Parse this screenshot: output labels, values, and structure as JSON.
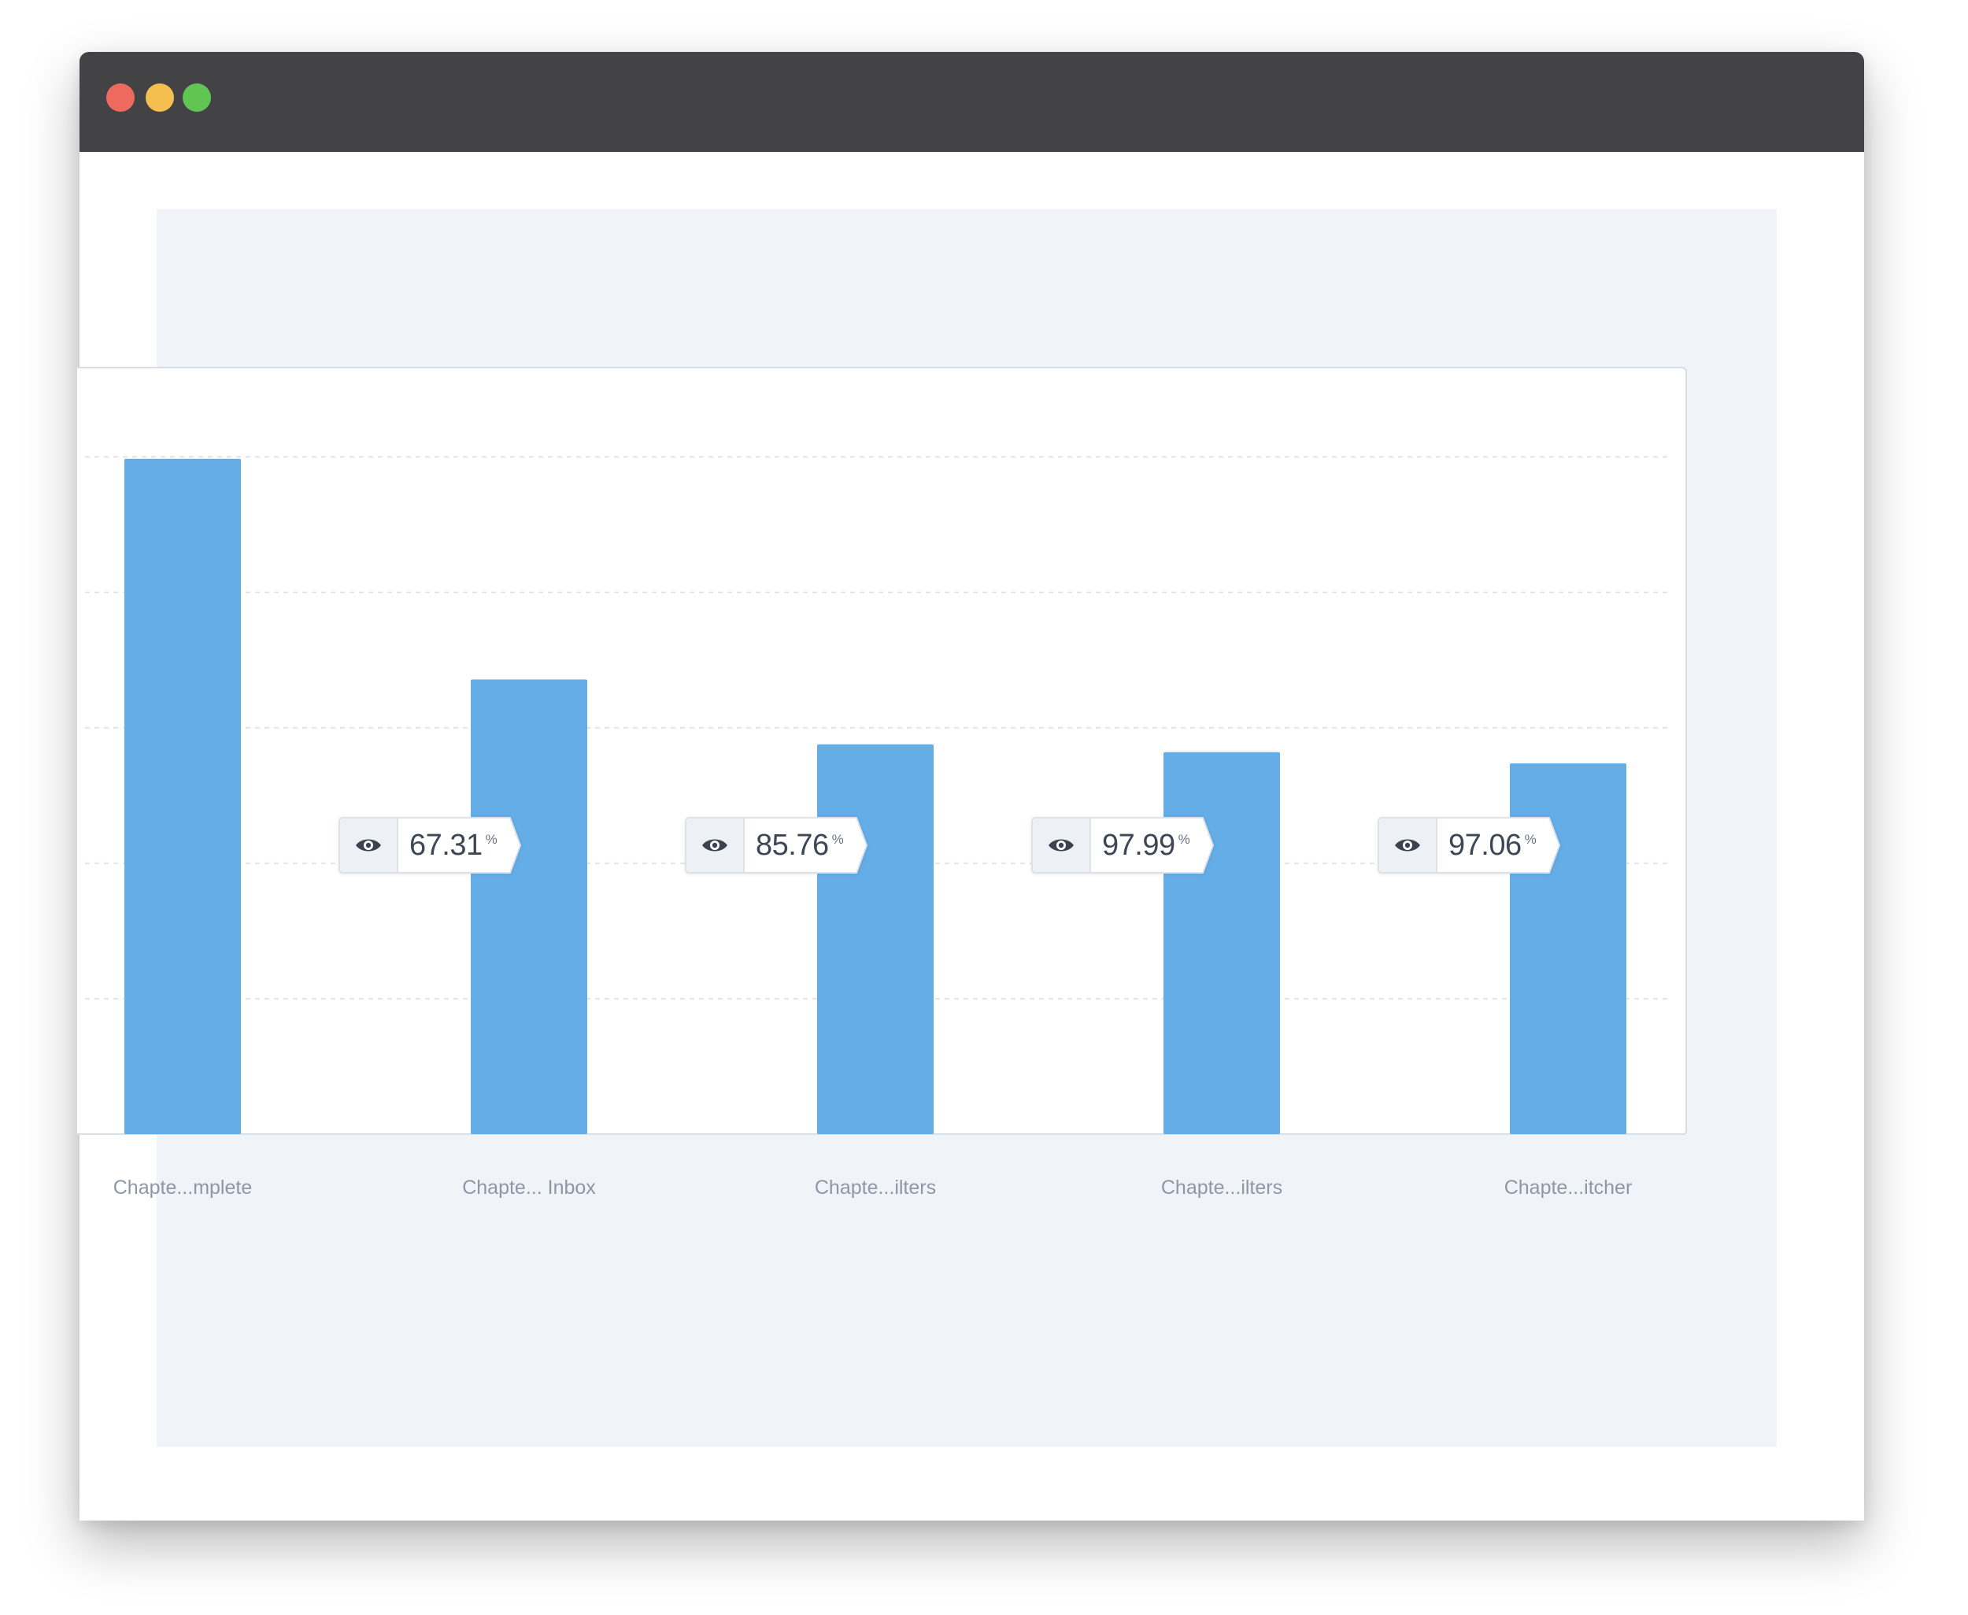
{
  "window": {
    "controls": [
      {
        "name": "close",
        "color": "#ec6a5e"
      },
      {
        "name": "minimize",
        "color": "#f5bf4f"
      },
      {
        "name": "maximize",
        "color": "#61c554"
      }
    ],
    "titlebar_color": "#434345",
    "panel_color": "#f0f3f8"
  },
  "chart_data": {
    "type": "bar",
    "categories": [
      "Chapte...mplete",
      "Chapte... Inbox",
      "Chapte...ilters",
      "Chapte...ilters",
      "Chapte...itcher"
    ],
    "values": [
      100,
      67.31,
      57.72,
      56.56,
      54.9
    ],
    "ylim": [
      0,
      105
    ],
    "grid": true,
    "bar_color": "#64ade6",
    "conversions": [
      {
        "icon": "eye-icon",
        "value": "67.31",
        "unit": "%"
      },
      {
        "icon": "eye-icon",
        "value": "85.76",
        "unit": "%"
      },
      {
        "icon": "eye-icon",
        "value": "97.99",
        "unit": "%"
      },
      {
        "icon": "eye-icon",
        "value": "97.06",
        "unit": "%"
      }
    ]
  }
}
